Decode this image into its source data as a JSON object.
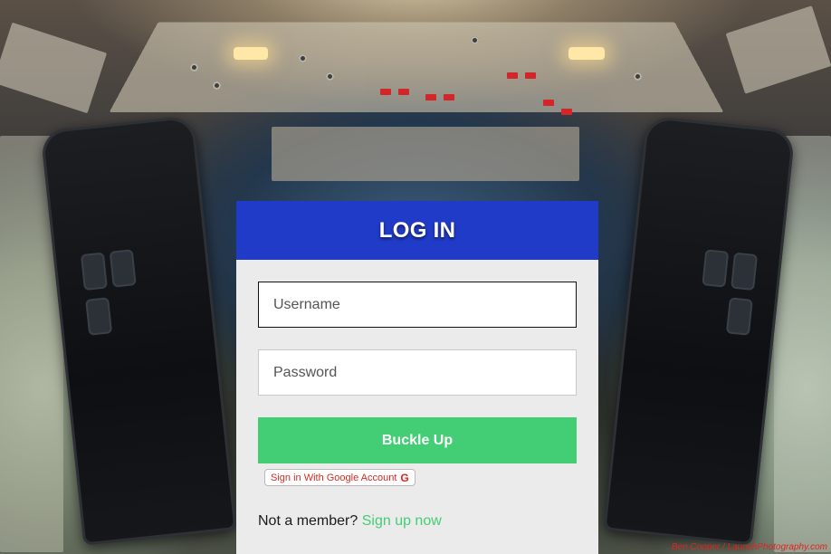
{
  "login": {
    "title": "LOG IN",
    "username_placeholder": "Username",
    "password_placeholder": "Password",
    "submit_label": "Buckle Up",
    "google_label": "Sign in With Google Account",
    "google_icon": "G",
    "footer_prompt": "Not a member?",
    "signup_label": "Sign up now"
  },
  "background": {
    "credit": "Ben Cooper / LaunchPhotography.com"
  },
  "colors": {
    "header": "#203bc7",
    "button": "#43cd75",
    "card": "#ebebeb",
    "link": "#43cd75",
    "google_text": "#d62b22"
  }
}
